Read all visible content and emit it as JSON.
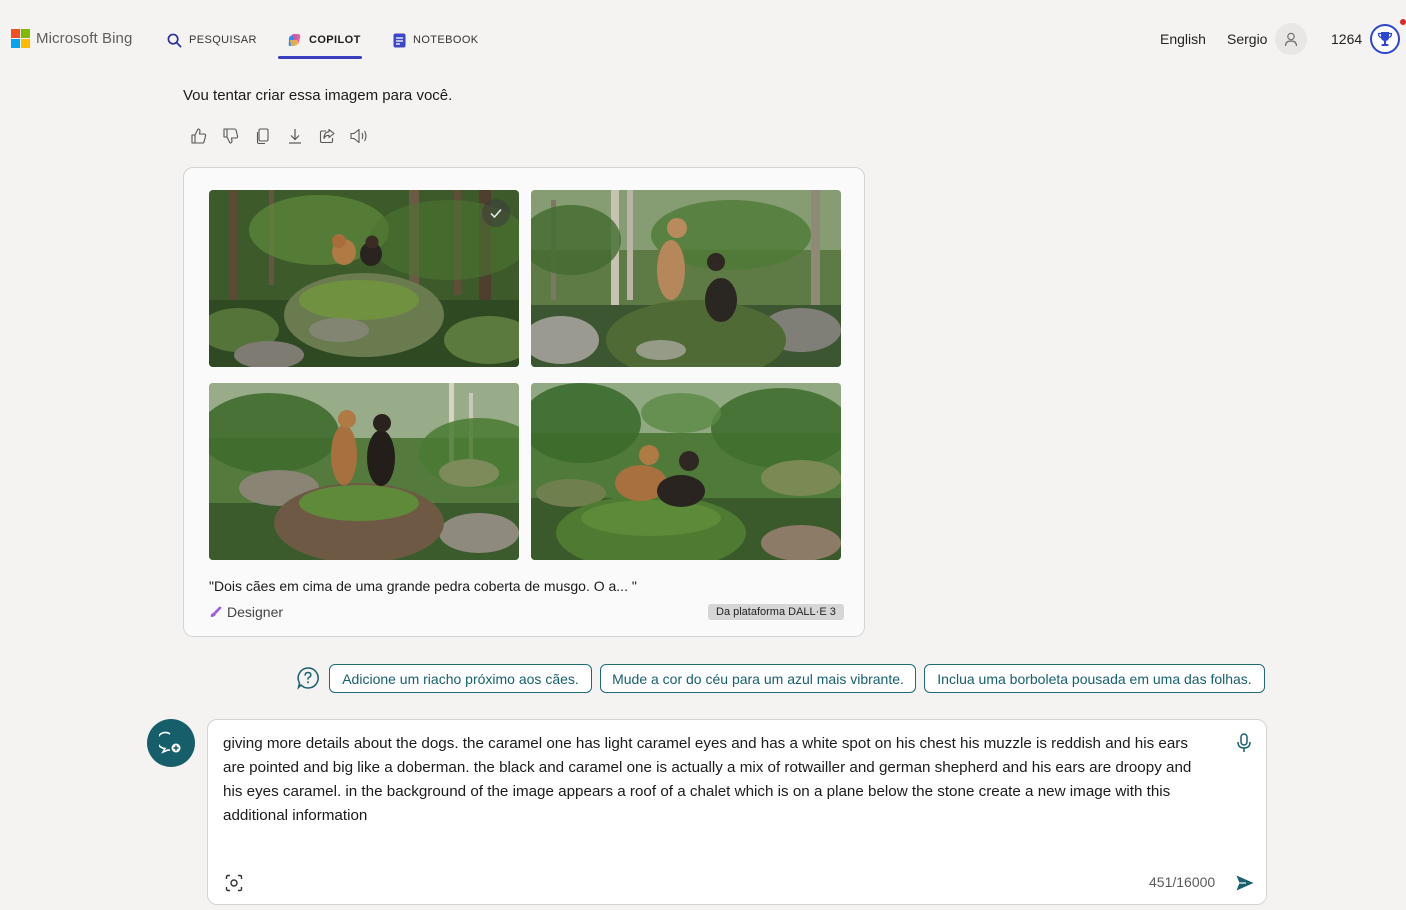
{
  "header": {
    "brand": "Microsoft Bing",
    "brand_colors": [
      "#f25022",
      "#7fba00",
      "#00a4ef",
      "#ffb900"
    ],
    "tabs": [
      {
        "label": "PESQUISAR",
        "icon": "search-icon",
        "active": false
      },
      {
        "label": "COPILOT",
        "icon": "copilot-icon",
        "active": true
      },
      {
        "label": "NOTEBOOK",
        "icon": "notebook-icon",
        "active": false
      }
    ],
    "language": "English",
    "user_name": "Sergio",
    "points": "1264"
  },
  "response": {
    "text": "Vou tentar criar essa imagem para você.",
    "actions": [
      "thumbs-up-icon",
      "thumbs-down-icon",
      "copy-icon",
      "download-icon",
      "share-icon",
      "read-aloud-icon"
    ]
  },
  "image_card": {
    "images": [
      {
        "selected": true
      },
      {
        "selected": false
      },
      {
        "selected": false
      },
      {
        "selected": false
      }
    ],
    "caption": "\"Dois cães em cima de uma grande pedra coberta de musgo. O a... \"",
    "designer_label": "Designer",
    "badge": "Da plataforma DALL·E 3"
  },
  "suggestions": [
    "Adicione um riacho próximo aos cães.",
    "Mude a cor do céu para um azul mais vibrante.",
    "Inclua uma borboleta pousada em uma das folhas."
  ],
  "composer": {
    "text": "giving more details about the dogs. the caramel one has light caramel eyes and has a white spot on his chest his muzzle is reddish and his ears are pointed and big like a doberman. the black and caramel one is actually a mix of rotwailler and german shepherd and his ears are droopy and his eyes caramel. in the background of the image appears a roof of a chalet which is on a plane below the stone create a new image with this additional information",
    "char_count": "451/16000"
  },
  "colors": {
    "accent": "#17606d",
    "tab_underline": "#3b3fbf",
    "rewards": "#2c46d1"
  }
}
